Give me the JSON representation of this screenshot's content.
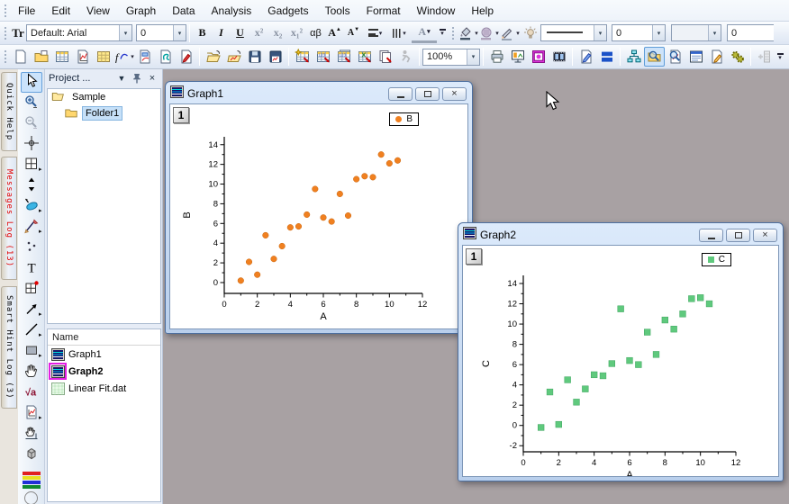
{
  "app": {
    "workspace_color": "#a8a1a3",
    "glyphs": {
      "dropdown": "▾",
      "flyout": "▸",
      "close": "×",
      "header_drop": "▼"
    }
  },
  "menu_bar": {
    "items": [
      "File",
      "Edit",
      "View",
      "Graph",
      "Data",
      "Analysis",
      "Gadgets",
      "Tools",
      "Format",
      "Window",
      "Help"
    ]
  },
  "format_toolbar": {
    "font_icon": "Tr",
    "font_value": "Default: Arial",
    "size_value": "0",
    "bold": "B",
    "italic": "I",
    "underline": "U",
    "superscript": "x²",
    "subscript": "x₂",
    "subsuperscript": "x₁²",
    "greek": "αβ",
    "grow_font": "A",
    "shrink_font": "A",
    "font_color": "A",
    "line_style_value": "",
    "line_width_value": "0",
    "pattern_value": "",
    "border_width_value": "0"
  },
  "standard_toolbar": {
    "zoom_value": "100%",
    "active": "project-explorer",
    "disabled": [
      "refresh",
      "add-columns"
    ],
    "carets": [
      "new-function"
    ],
    "icons": [
      "new-project",
      "new-folder",
      "new-workbook",
      "new-graph",
      "new-matrix",
      "new-function",
      "new-layout",
      "new-notes",
      "new-report",
      "|",
      "open",
      "open-template",
      "save",
      "save-template",
      "|",
      "import-wizard",
      "import-ascii",
      "import-multi",
      "import-excel",
      "batch-import",
      "refresh",
      "|",
      "zoom-combo",
      "|",
      "print",
      "slide-show",
      "video-player",
      "make-movie",
      "|",
      "edit-page",
      "tile-windows",
      "|",
      "project-folders",
      "project-explorer",
      "results-log",
      "script-window",
      "command-window",
      "code-builder",
      "|",
      "add-columns",
      "overflow"
    ]
  },
  "tools_toolbar": {
    "items": [
      {
        "name": "pointer",
        "selected": true
      },
      {
        "name": "zoom-in"
      },
      {
        "name": "zoom-out",
        "disabled": true
      },
      {
        "name": "screen-reader"
      },
      {
        "name": "quad-region",
        "caret": true
      },
      {
        "name": "data-reader"
      },
      {
        "name": "region-selector",
        "caret": true
      },
      {
        "name": "mask-pencil",
        "caret": true
      },
      {
        "name": "cluster-gadget"
      },
      {
        "name": "text-tool"
      },
      {
        "name": "rect-annotation"
      },
      {
        "name": "arrow-tool",
        "caret": true
      },
      {
        "name": "line-tool",
        "caret": true
      },
      {
        "name": "rectangle-tool",
        "caret": true
      },
      {
        "name": "pan-tool"
      },
      {
        "name": "equation-tool"
      },
      {
        "name": "insert-graph",
        "caret": true
      },
      {
        "name": "scale-tool"
      },
      {
        "name": "object-3d"
      }
    ],
    "palette_colors": [
      "#e02020",
      "#e8e020",
      "#2030d8",
      "#108a30"
    ]
  },
  "side_tabs": [
    {
      "label": "Quick Help",
      "color": "#000000"
    },
    {
      "label": "Messages Log (13)",
      "color": "#e00000"
    },
    {
      "label": "Smart Hint Log (3)",
      "color": "#000000"
    }
  ],
  "project_explorer": {
    "title": "Project ...",
    "tree": [
      {
        "label": "Sample",
        "icon": "folder-open",
        "level": 0
      },
      {
        "label": "Folder1",
        "icon": "folder",
        "level": 1,
        "selected": true
      }
    ],
    "list_header": "Name",
    "files": [
      {
        "label": "Graph1",
        "icon": "graph"
      },
      {
        "label": "Graph2",
        "icon": "graph",
        "bold": true,
        "active": true
      },
      {
        "label": "Linear Fit.dat",
        "icon": "data"
      }
    ]
  },
  "windows": [
    {
      "title": "Graph1",
      "layer_badge": "1"
    },
    {
      "title": "Graph2",
      "layer_badge": "1"
    }
  ],
  "chart_data": [
    {
      "type": "scatter",
      "window_title": "Graph1",
      "xlabel": "A",
      "ylabel": "B",
      "xlim": [
        0,
        12
      ],
      "ylim": [
        -1.1,
        14.8
      ],
      "x_ticks": [
        0,
        2,
        4,
        6,
        8,
        10,
        12
      ],
      "y_ticks": [
        0,
        2,
        4,
        6,
        8,
        10,
        12,
        14
      ],
      "grid": false,
      "legend_position": "top-right",
      "series": [
        {
          "name": "B",
          "marker": "circle",
          "color": "#F08020",
          "x": [
            1,
            1.5,
            2,
            2.5,
            3,
            3.5,
            4,
            4.5,
            5,
            5.5,
            6,
            6.5,
            7,
            7.5,
            8,
            8.5,
            9,
            9.5,
            10,
            10.5
          ],
          "y": [
            0.2,
            2.1,
            0.8,
            4.8,
            2.4,
            3.7,
            5.6,
            5.7,
            6.9,
            9.5,
            6.6,
            6.2,
            9.0,
            6.8,
            10.5,
            10.8,
            10.7,
            13.0,
            12.1,
            12.4
          ]
        }
      ]
    },
    {
      "type": "scatter",
      "window_title": "Graph2",
      "xlabel": "A",
      "ylabel": "C",
      "xlim": [
        0,
        12
      ],
      "ylim": [
        -2.6,
        14.8
      ],
      "x_ticks": [
        0,
        2,
        4,
        6,
        8,
        10,
        12
      ],
      "y_ticks": [
        -2,
        0,
        2,
        4,
        6,
        8,
        10,
        12,
        14
      ],
      "grid": false,
      "legend_position": "top-right",
      "series": [
        {
          "name": "C",
          "marker": "square",
          "color": "#5FC97D",
          "x": [
            1,
            1.5,
            2,
            2.5,
            3,
            3.5,
            4,
            4.5,
            5,
            5.5,
            6,
            6.5,
            7,
            7.5,
            8,
            8.5,
            9,
            9.5,
            10,
            10.5
          ],
          "y": [
            -0.2,
            3.3,
            0.1,
            4.5,
            2.3,
            3.6,
            5.0,
            4.9,
            6.1,
            11.5,
            6.4,
            6.0,
            9.2,
            7.0,
            10.4,
            9.5,
            11.0,
            12.5,
            12.6,
            12.0
          ]
        }
      ]
    }
  ]
}
